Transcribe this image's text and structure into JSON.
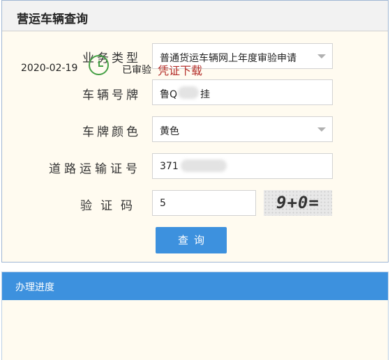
{
  "query_panel": {
    "title": "营运车辆查询",
    "fields": {
      "business_type": {
        "label": "业务类型",
        "value": "普通货运车辆网上年度审验申请"
      },
      "plate_number": {
        "label": "车辆号牌",
        "value_prefix": "鲁Q",
        "value_suffix": "挂"
      },
      "plate_color": {
        "label": "车牌颜色",
        "value": "黄色"
      },
      "transport_cert": {
        "label": "道路运输证号",
        "value_prefix": "371"
      },
      "captcha": {
        "label": "验证码",
        "value": "5",
        "image_text": "9+0="
      }
    },
    "submit_label": "查询"
  },
  "progress_panel": {
    "title": "办理进度",
    "items": [
      {
        "date": "2020-02-19",
        "status": "已审验",
        "link": "凭证下载"
      }
    ]
  },
  "colors": {
    "accent": "#3d91de",
    "success": "#45a045",
    "link": "#b5302b"
  },
  "icons": [
    "chevron-down-icon",
    "clock-icon"
  ]
}
